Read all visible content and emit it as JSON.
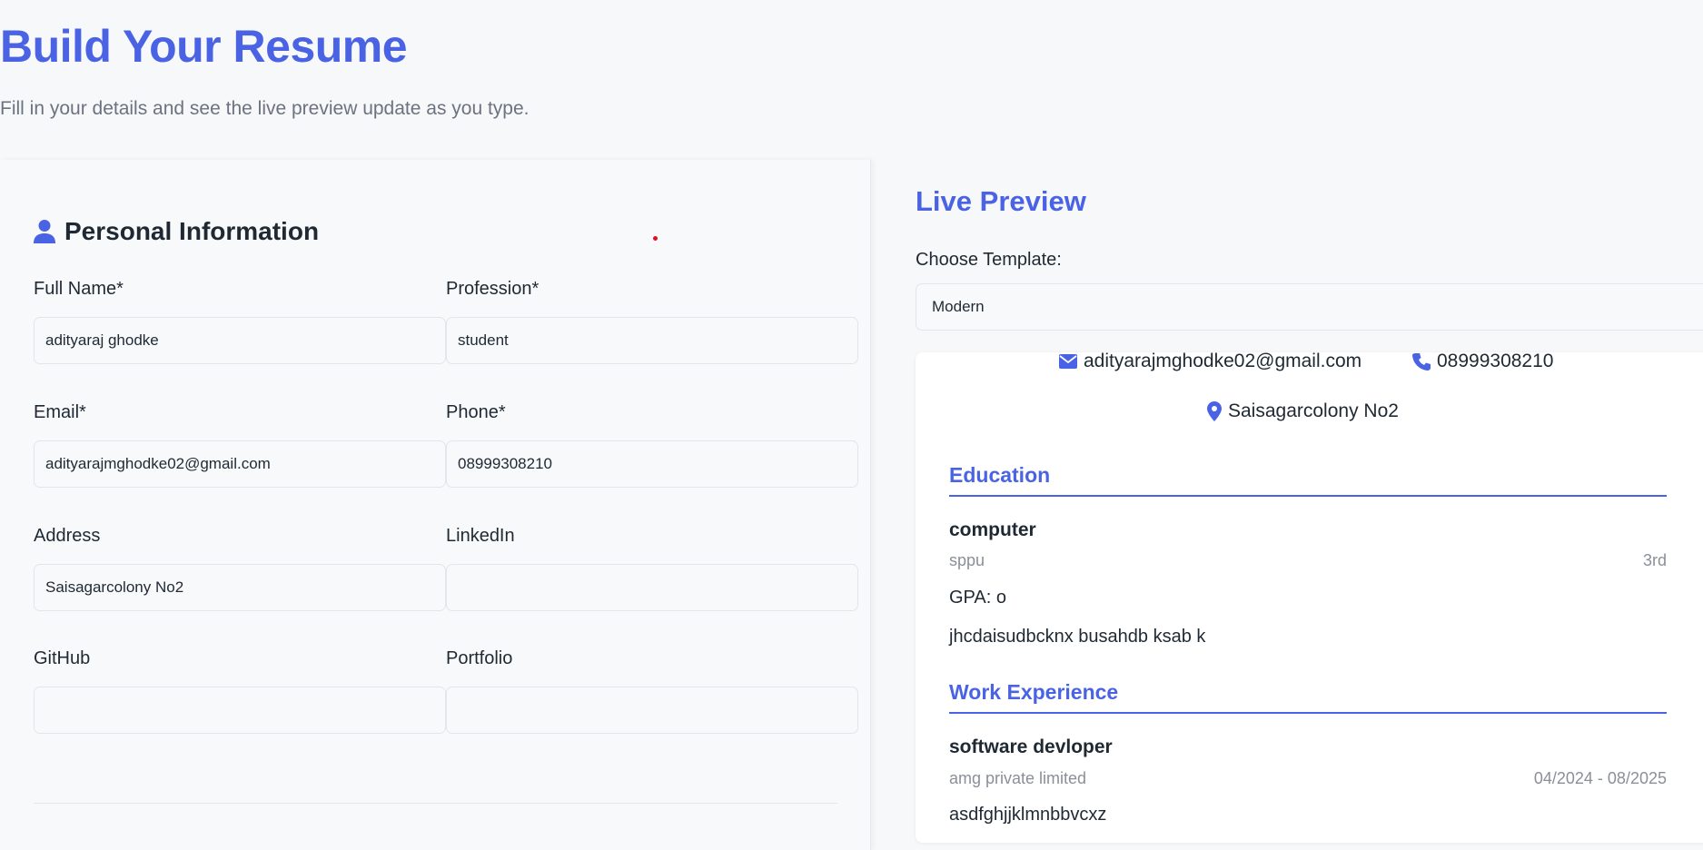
{
  "header": {
    "title": "Build Your Resume",
    "subtitle": "Fill in your details and see the live preview update as you type."
  },
  "form": {
    "section_title": "Personal Information",
    "fields": {
      "full_name": {
        "label": "Full Name*",
        "value": "adityaraj ghodke"
      },
      "profession": {
        "label": "Profession*",
        "value": "student"
      },
      "email": {
        "label": "Email*",
        "value": "adityarajmghodke02@gmail.com"
      },
      "phone": {
        "label": "Phone*",
        "value": "08999308210"
      },
      "address": {
        "label": "Address",
        "value": "Saisagarcolony No2"
      },
      "linkedin": {
        "label": "LinkedIn",
        "value": ""
      },
      "github": {
        "label": "GitHub",
        "value": ""
      },
      "portfolio": {
        "label": "Portfolio",
        "value": ""
      }
    }
  },
  "preview": {
    "title": "Live Preview",
    "template_label": "Choose Template:",
    "template_selected": "Modern",
    "contact": {
      "email": "adityarajmghodke02@gmail.com",
      "phone": "08999308210",
      "address": "Saisagarcolony No2"
    },
    "education": {
      "heading": "Education",
      "degree": "computer",
      "institution": "sppu",
      "year": "3rd",
      "gpa": "GPA: o",
      "description": "jhcdaisudbcknx busahdb ksab k"
    },
    "experience": {
      "heading": "Work Experience",
      "role": "software devloper",
      "company": "amg private limited",
      "dates": "04/2024 - 08/2025",
      "description": "asdfghjjklmnbbvcxz"
    }
  },
  "colors": {
    "accent": "#4a63e4",
    "text": "#1f2933",
    "muted": "#8a8f98",
    "background": "#f7f8fa"
  },
  "icons": [
    "user-icon",
    "envelope-icon",
    "phone-icon",
    "map-pin-icon"
  ]
}
